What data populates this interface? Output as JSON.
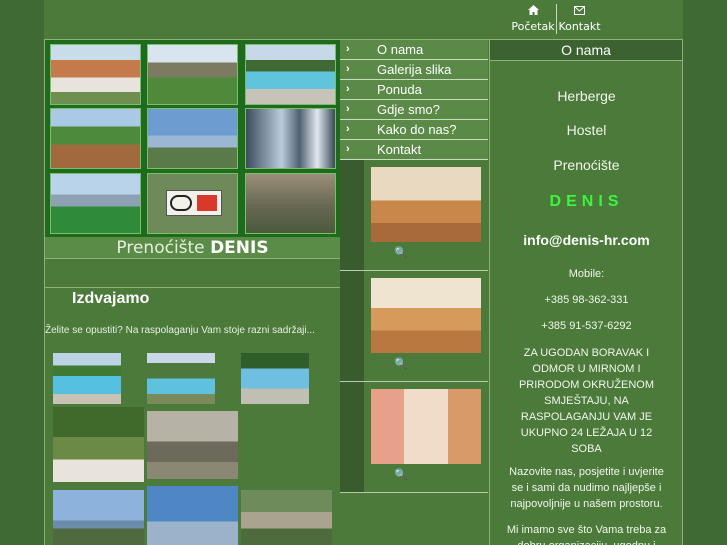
{
  "topbar": {
    "home": {
      "label": "Početak",
      "icon": "home-icon"
    },
    "contact": {
      "label": "Kontakt",
      "icon": "envelope-icon"
    }
  },
  "brand": {
    "prefix": "Prenoćište",
    "name": "DENIS"
  },
  "featured": {
    "title": "Izdvajamo",
    "subtitle": "Želite se opustiti? Na raspolaganju Vam stoje razni sadržaji..."
  },
  "nav": {
    "items": [
      {
        "label": "O nama"
      },
      {
        "label": "Galerija slika"
      },
      {
        "label": "Ponuda"
      },
      {
        "label": "Gdje smo?"
      },
      {
        "label": "Kako do nas?"
      },
      {
        "label": "Kontakt"
      }
    ]
  },
  "info": {
    "heading": "O nama",
    "line1": "Herberge",
    "line2": "Hostel",
    "line3": "Prenoćište",
    "brand": "DENIS",
    "email": "info@denis-hr.com",
    "mobile_label": "Mobile:",
    "phone1": "+385 98-362-331",
    "phone2": "+385 91-537-6292",
    "desc1": "ZA UGODAN BORAVAK I ODMOR U MIRNOM I PRIRODOM OKRUŽENOM SMJEŠTAJU, NA RASPOLAGANJU VAM JE UKUPNO 24 LEŽAJA U 12 SOBA",
    "desc2": "Nazovite nas, posjetite i uvjerite se i sami da nudimo najljepše i najpovoljnije u našem prostoru.",
    "desc3": "Mi imamo sve što Vama treba za dobru organizaciju, ugodnu i"
  },
  "colors": {
    "accent_green": "#3cf53c",
    "panel": "#4b7a3a",
    "menu": "#5b8a48"
  }
}
